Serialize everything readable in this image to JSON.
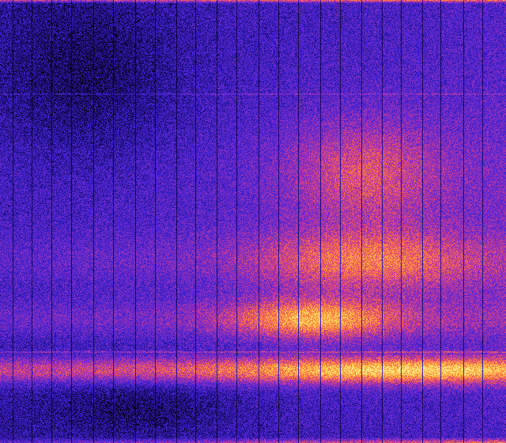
{
  "image": {
    "kind": "spectrogram-like heatmap",
    "colormap": [
      "#000000",
      "#1a0b6b",
      "#3b22d6",
      "#7a2cc9",
      "#d43c8c",
      "#ff7a3a",
      "#ffd24a",
      "#fff6b0"
    ],
    "background": "#000000",
    "bands": [
      {
        "label": "",
        "intensity": 0.95,
        "center_fraction": 0.835,
        "width_fraction": 0.03
      },
      {
        "label": "",
        "intensity": 0.85,
        "center_fraction": 0.72,
        "width_fraction": 0.045
      },
      {
        "label": "",
        "intensity": 0.6,
        "center_fraction": 0.59,
        "width_fraction": 0.07
      },
      {
        "label": "",
        "intensity": 0.45,
        "center_fraction": 0.39,
        "width_fraction": 0.12
      }
    ]
  }
}
